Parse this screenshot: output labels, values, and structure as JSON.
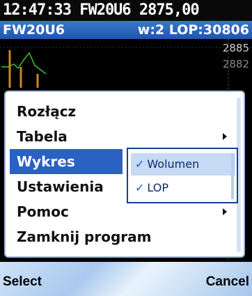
{
  "status": {
    "line1": "12:47:33 FW20U6 2875,00"
  },
  "subbar": {
    "left": "FW20U6",
    "right": "w:2 LOP:30806"
  },
  "chart": {
    "price_top": "2885",
    "price_second": "2882"
  },
  "menu": {
    "items": [
      {
        "label": "Rozłącz"
      },
      {
        "label": "Tabela"
      },
      {
        "label": "Wykres"
      },
      {
        "label": "Ustawienia"
      },
      {
        "label": "Pomoc"
      },
      {
        "label": "Zamknij program"
      }
    ]
  },
  "submenu": {
    "items": [
      {
        "label": "Wolumen",
        "checked": true
      },
      {
        "label": "LOP",
        "checked": true
      }
    ],
    "check_glyph": "✓"
  },
  "softkeys": {
    "left": "Select",
    "right": "Cancel"
  }
}
